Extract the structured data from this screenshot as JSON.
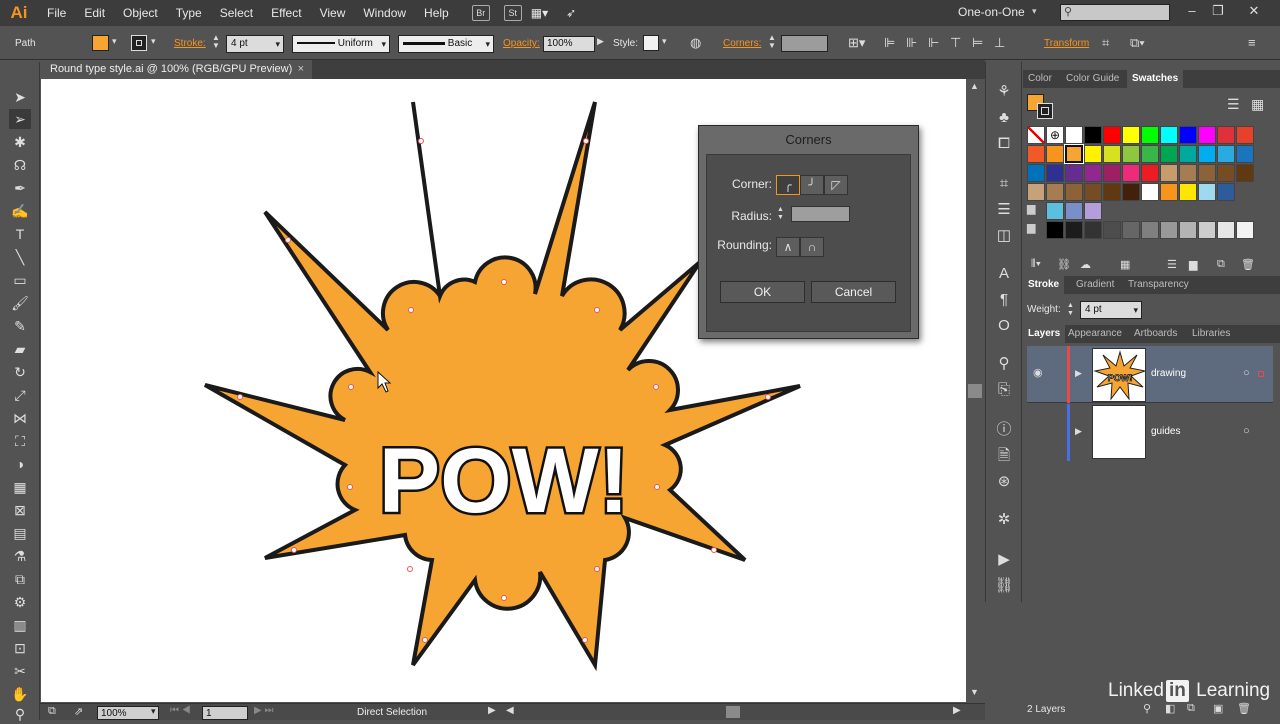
{
  "app": {
    "logo": "Ai"
  },
  "menubar": {
    "items": [
      "File",
      "Edit",
      "Object",
      "Type",
      "Select",
      "Effect",
      "View",
      "Window",
      "Help"
    ],
    "bridge": "Br",
    "stock": "St",
    "workspace": "One-on-One",
    "window_controls": [
      "–",
      "❐",
      "✕"
    ]
  },
  "controlbar": {
    "selection_type": "Path",
    "fill_color": "#f7a532",
    "stroke_label": "Stroke:",
    "stroke_weight": "4 pt",
    "profile_label": "Uniform",
    "brush_label": "Basic",
    "opacity_label": "Opacity:",
    "opacity_value": "100%",
    "style_label": "Style:",
    "corners_label": "Corners:",
    "transform_label": "Transform"
  },
  "document": {
    "tab_title": "Round type style.ai @ 100% (RGB/GPU Preview)",
    "close": "×"
  },
  "artwork": {
    "headline": "POW!",
    "fill": "#f7a532",
    "stroke": "#1a1a1a"
  },
  "corners_dialog": {
    "title": "Corners",
    "corner_label": "Corner:",
    "radius_label": "Radius:",
    "rounding_label": "Rounding:",
    "ok_label": "OK",
    "cancel_label": "Cancel"
  },
  "swatches_panel": {
    "tabs": [
      "Color",
      "Color Guide",
      "Swatches"
    ],
    "active_tab": "Swatches",
    "rows": [
      [
        "#ffffff",
        "#ffffff",
        "#ffffff",
        "#000000",
        "#ff0000",
        "#ffff00",
        "#00ff00",
        "#00ffff",
        "#0000ff",
        "#ff00ff",
        "#e0303a",
        "#e8412a"
      ],
      [
        "#f05a28",
        "#f7941d",
        "#f7a532",
        "#fff200",
        "#d7e021",
        "#8dc63f",
        "#39b54a",
        "#00a651",
        "#00a99d",
        "#00aeef",
        "#29abe2",
        "#1b75bc"
      ],
      [
        "#0072bc",
        "#2e3192",
        "#662d91",
        "#92278f",
        "#9e1f63",
        "#ee2a7b",
        "#ed1c24",
        "#c69c6d",
        "#a67c52",
        "#8c6239",
        "#754c24",
        "#603913"
      ],
      [
        "#c7a17a",
        "#a67c52",
        "#8c6239",
        "#754c24",
        "#603913",
        "#42210b",
        "#ffffff",
        "#f7941d",
        "#ffe600",
        "#9fd9ef",
        "#2e5c9a"
      ],
      [
        "#5bc0de",
        "#7a8fc8",
        "#b39ddb"
      ],
      [
        "#000000",
        "#1c1c1c",
        "#333333",
        "#4d4d4d",
        "#666666",
        "#808080",
        "#999999",
        "#b3b3b3",
        "#cccccc",
        "#e6e6e6",
        "#f2f2f2"
      ]
    ]
  },
  "stroke_panel": {
    "tabs": [
      "Stroke",
      "Gradient",
      "Transparency"
    ],
    "active_tab": "Stroke",
    "weight_label": "Weight:",
    "weight_value": "4 pt"
  },
  "layers_panel": {
    "tabs": [
      "Layers",
      "Appearance",
      "Artboards",
      "Libraries"
    ],
    "active_tab": "Layers",
    "layers": [
      {
        "name": "drawing",
        "color": "#e84a4a",
        "thumb_text": "POW!"
      },
      {
        "name": "guides",
        "color": "#4a6ee8",
        "thumb_text": ""
      }
    ],
    "count": "2 Layers"
  },
  "statusbar": {
    "zoom": "100%",
    "artboard": "1",
    "tool": "Direct Selection"
  },
  "watermark": {
    "before": "Linked",
    "in": "in",
    "after": " Learning"
  }
}
